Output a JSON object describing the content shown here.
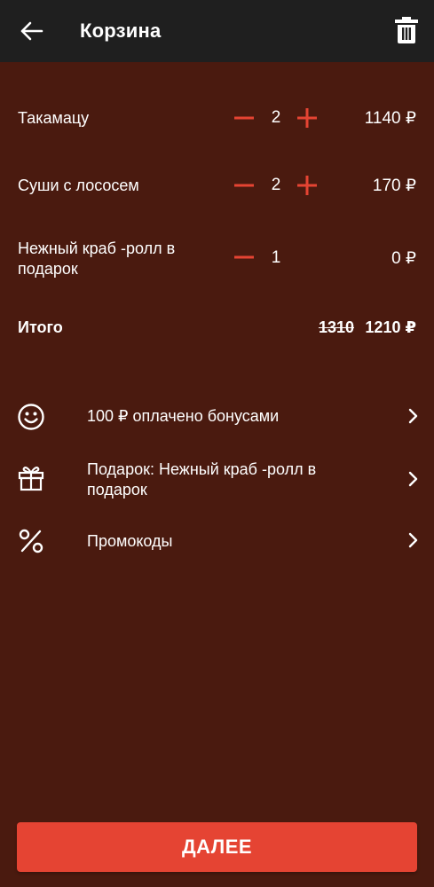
{
  "colors": {
    "appbar": "#1f1f1f",
    "background": "#4a1a0f",
    "accent": "#e54433",
    "text": "#ffffff"
  },
  "header": {
    "title": "Корзина",
    "back_icon": "arrow-left-icon",
    "delete_icon": "trash-icon"
  },
  "cart": {
    "items": [
      {
        "name": "Такамацу",
        "qty": "2",
        "price": "1140 ₽",
        "has_plus": true
      },
      {
        "name": "Суши с лососем",
        "qty": "2",
        "price": "170 ₽",
        "has_plus": true
      },
      {
        "name": "Нежный краб -ролл в подарок",
        "qty": "1",
        "price": "0 ₽",
        "has_plus": false
      }
    ],
    "total": {
      "label": "Итого",
      "old_price": "1310",
      "new_price": "1210 ₽"
    }
  },
  "options": [
    {
      "icon": "smile-icon",
      "text": "100 ₽ оплачено бонусами"
    },
    {
      "icon": "gift-icon",
      "text": "Подарок: Нежный краб -ролл в подарок"
    },
    {
      "icon": "percent-icon",
      "text": "Промокоды"
    }
  ],
  "footer": {
    "next_label": "ДАЛЕЕ"
  }
}
